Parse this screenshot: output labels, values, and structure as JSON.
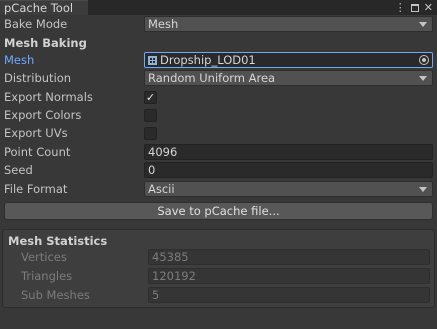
{
  "window": {
    "tab_title": "pCache Tool",
    "icons": [
      "kebab-menu-icon",
      "maximize-icon",
      "close-icon"
    ]
  },
  "bake_mode": {
    "label": "Bake Mode",
    "value": "Mesh"
  },
  "mesh_baking": {
    "header": "Mesh Baking",
    "mesh": {
      "label": "Mesh",
      "value": "Dropship_LOD01"
    },
    "distribution": {
      "label": "Distribution",
      "value": "Random Uniform Area"
    },
    "export_normals": {
      "label": "Export Normals",
      "checked": true,
      "mark": "✓"
    },
    "export_colors": {
      "label": "Export Colors",
      "checked": false
    },
    "export_uvs": {
      "label": "Export UVs",
      "checked": false
    },
    "point_count": {
      "label": "Point Count",
      "value": "4096"
    },
    "seed": {
      "label": "Seed",
      "value": "0"
    },
    "file_format": {
      "label": "File Format",
      "value": "Ascii"
    }
  },
  "save_button": "Save to pCache file...",
  "mesh_statistics": {
    "title": "Mesh Statistics",
    "vertices": {
      "label": "Vertices",
      "value": "45385"
    },
    "triangles": {
      "label": "Triangles",
      "value": "120192"
    },
    "sub_meshes": {
      "label": "Sub Meshes",
      "value": "5"
    }
  },
  "colors": {
    "background": "#383838",
    "field": "#2a2a2a",
    "dropdown": "#515151",
    "highlight": "#6fa8ff",
    "text": "#c4c4c4"
  }
}
